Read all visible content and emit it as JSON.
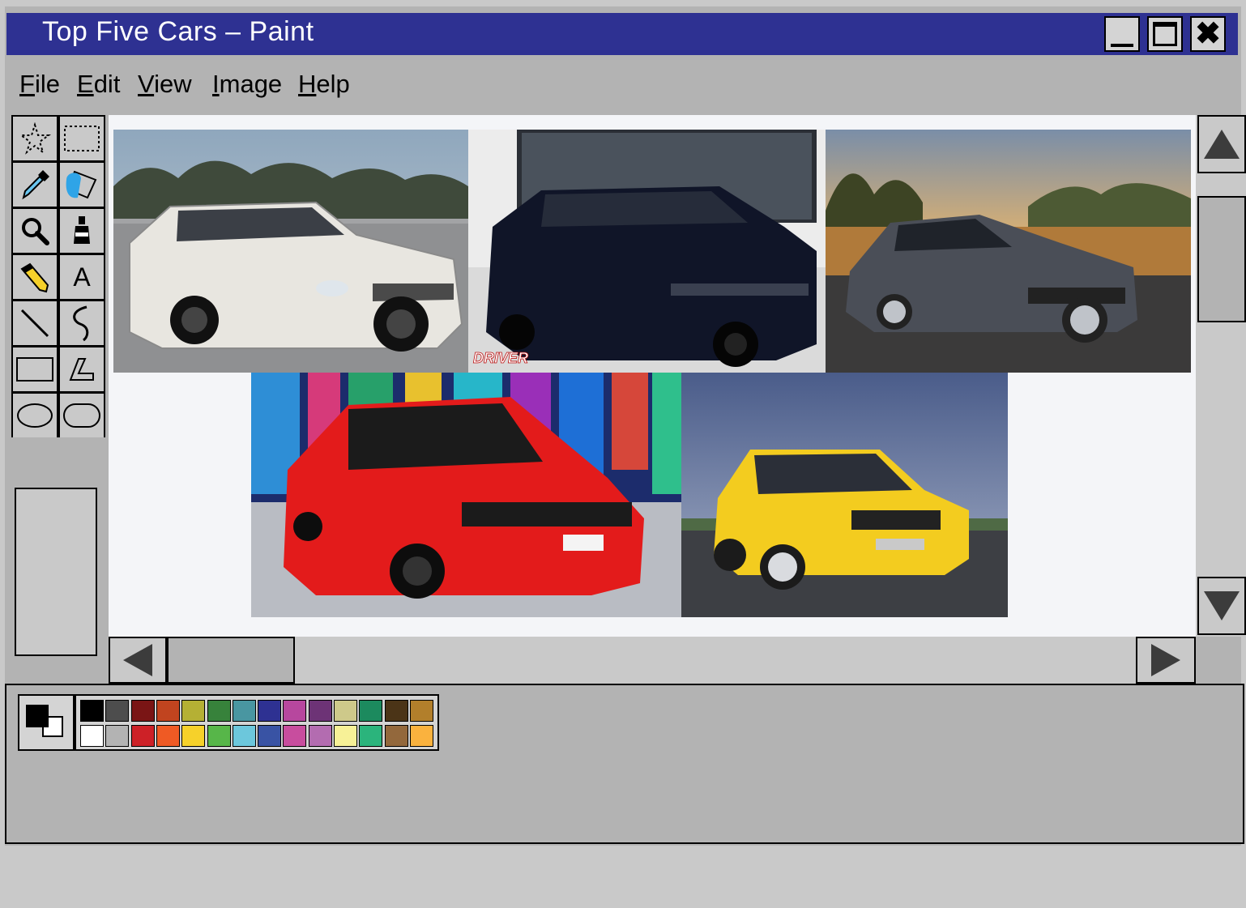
{
  "window": {
    "title": "Top Five Cars – Paint",
    "controls": {
      "minimize_icon": "minimize-icon",
      "maximize_icon": "maximize-icon",
      "close_glyph": "✖"
    }
  },
  "menu": {
    "file": "File",
    "edit": "Edit",
    "view": "View",
    "image": "Image",
    "help": "Help"
  },
  "tools": [
    "free-form-select-icon",
    "rectangle-select-icon",
    "eyedropper-icon",
    "eraser-icon",
    "magnifier-icon",
    "paint-bucket-icon",
    "pencil-icon",
    "text-icon",
    "line-icon",
    "curve-icon",
    "rectangle-icon",
    "polygon-icon",
    "ellipse-icon",
    "rounded-rectangle-icon"
  ],
  "tool_text_glyph": "A",
  "canvas": {
    "images": [
      {
        "name": "white-station-wagon-photo",
        "body_color": "#e8e6e0",
        "sky": "#9fb5c9"
      },
      {
        "name": "black-sedan-photo",
        "body_color": "#101528",
        "watermark": "DRIVER"
      },
      {
        "name": "grey-evo-sedan-photo",
        "body_color": "#4a4e57",
        "sky": "#e0a657"
      },
      {
        "name": "red-civic-photo",
        "body_color": "#e31b1b"
      },
      {
        "name": "yellow-audi-wagon-photo",
        "body_color": "#f3cc1f",
        "sky": "#5b6f9e"
      }
    ]
  },
  "scrollbar": {
    "up_icon": "arrow-up-icon",
    "down_icon": "arrow-down-icon",
    "left_icon": "arrow-left-icon",
    "right_icon": "arrow-right-icon"
  },
  "colors": {
    "foreground": "#000000",
    "background": "#ffffff",
    "palette_top": [
      "#000000",
      "#4d4d4d",
      "#7a1515",
      "#c1441f",
      "#b5b034",
      "#37823b",
      "#4996a1",
      "#2e3192",
      "#b7479e",
      "#6d3376",
      "#cec98a",
      "#1c8a5e",
      "#4b3417",
      "#b27f2b"
    ],
    "palette_bottom": [
      "#ffffff",
      "#b3b3b3",
      "#cd2127",
      "#ef5a24",
      "#f6d12a",
      "#57b649",
      "#6cc7dc",
      "#3953a4",
      "#c84d9e",
      "#b36cb0",
      "#f7f197",
      "#2bb47c",
      "#93683c",
      "#fab23e"
    ]
  }
}
